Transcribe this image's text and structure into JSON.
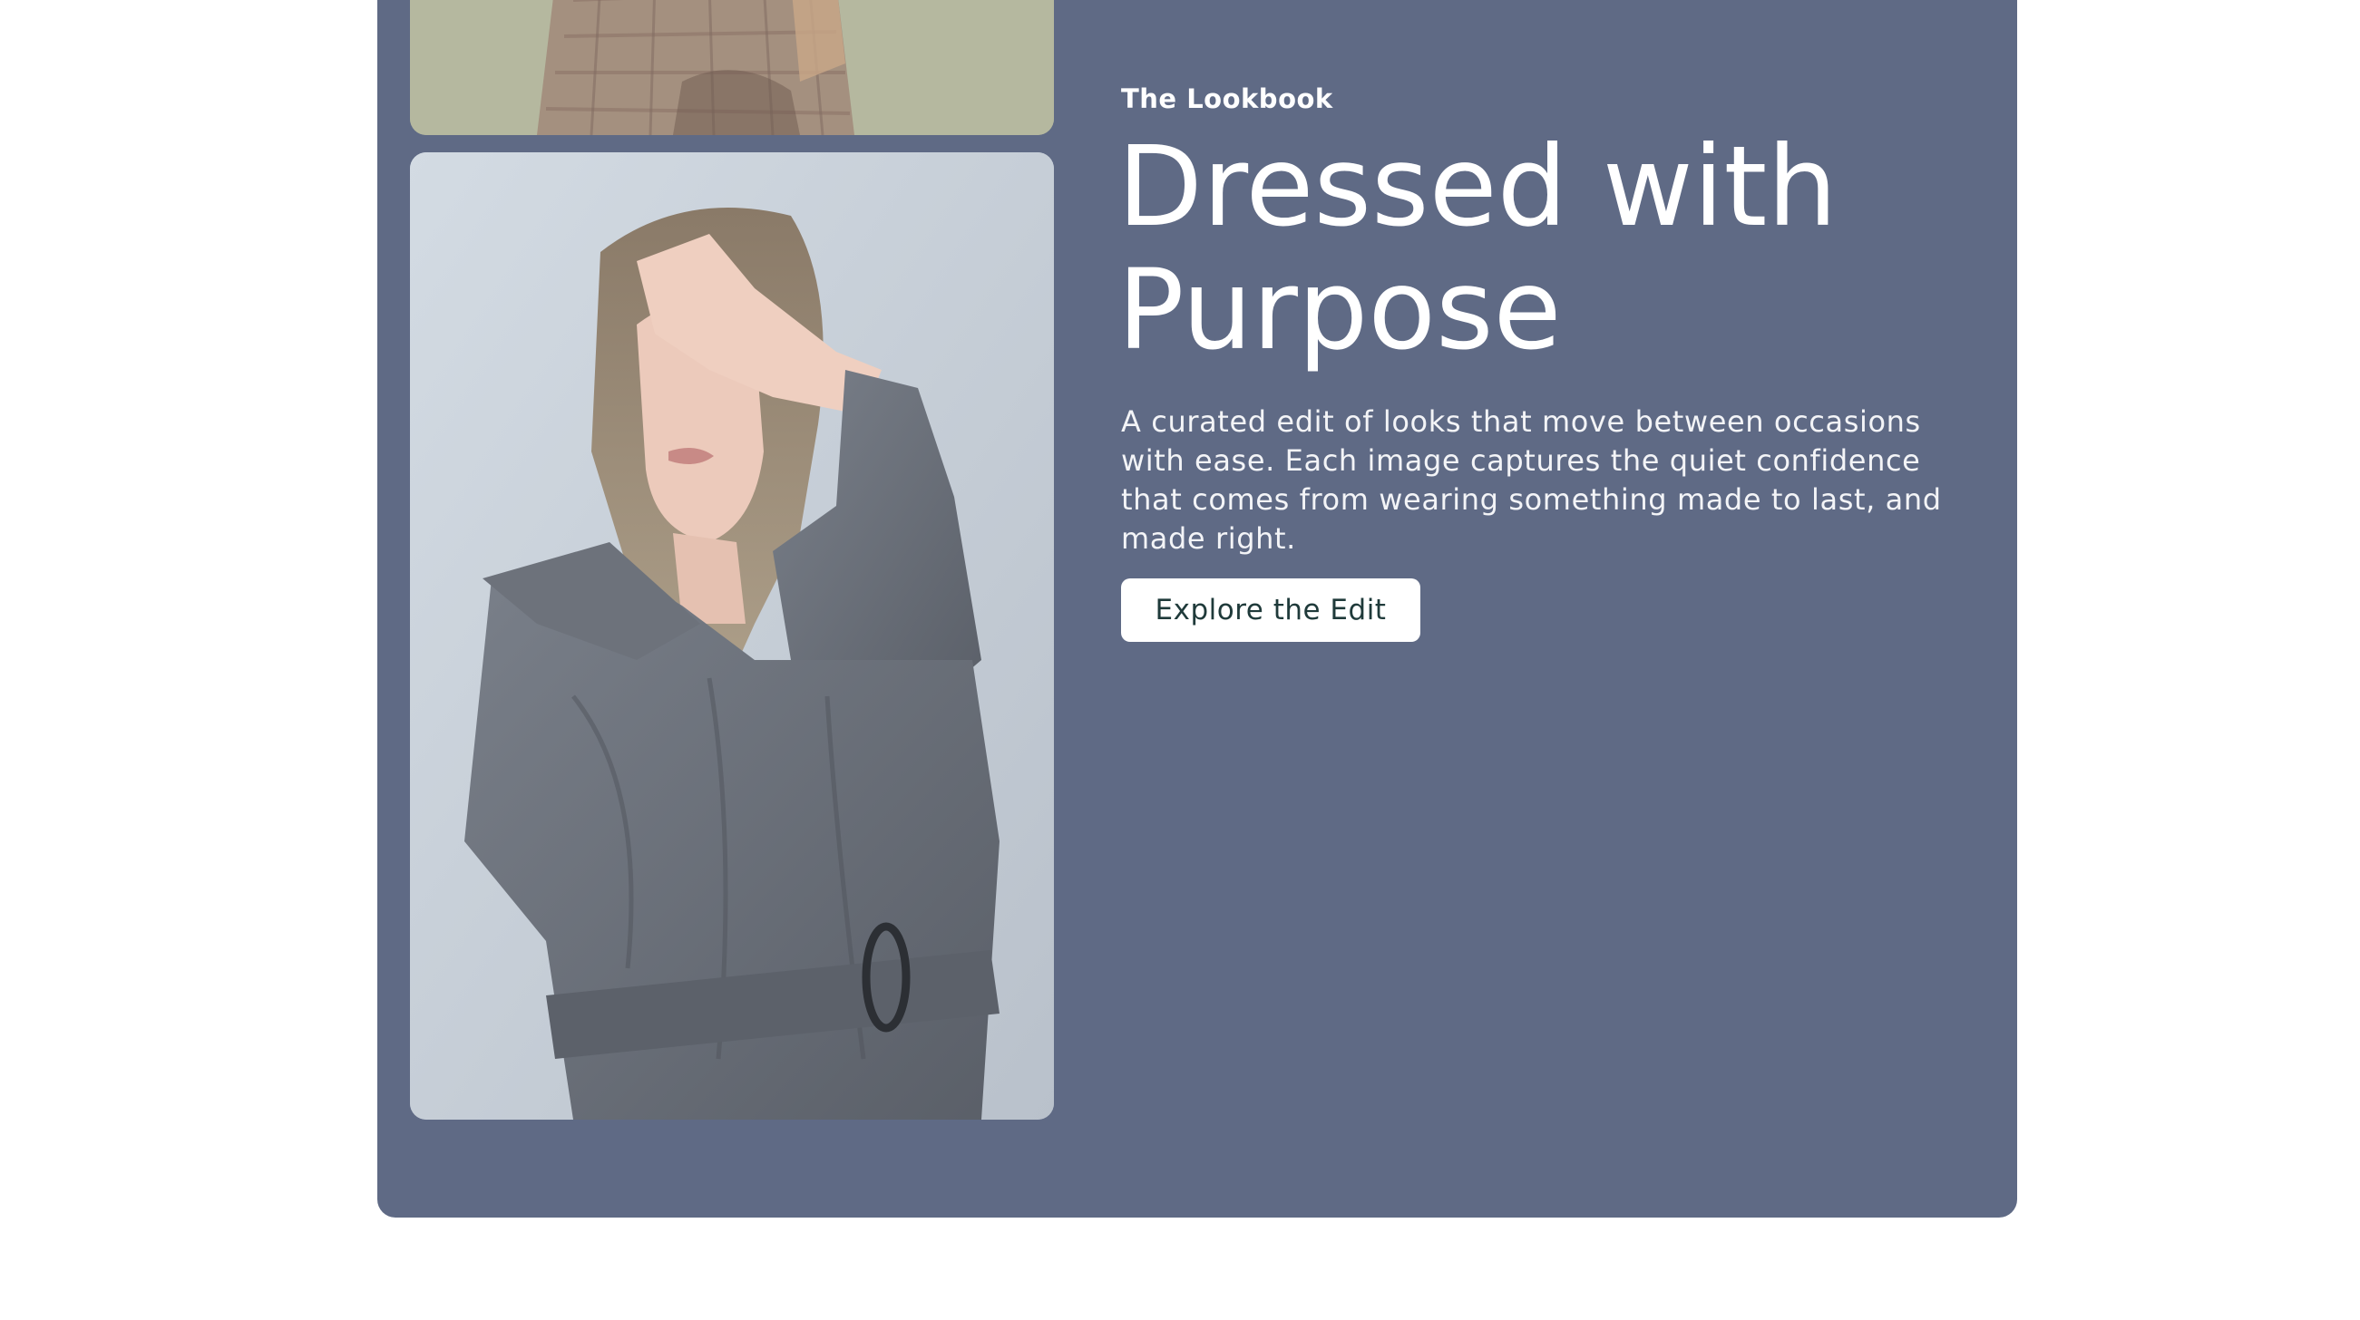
{
  "lookbook": {
    "eyebrow": "The Lookbook",
    "headline": "Dressed with Purpose",
    "body": "A curated edit of looks that move between occasions with ease. Each image captures the quiet confidence that comes from wearing something made to last, and made right.",
    "cta_label": "Explore the Edit"
  },
  "colors": {
    "card_background": "#5f6a85",
    "page_background": "#ffffff",
    "cta_background": "#ffffff",
    "cta_text": "#1f3a3a"
  }
}
